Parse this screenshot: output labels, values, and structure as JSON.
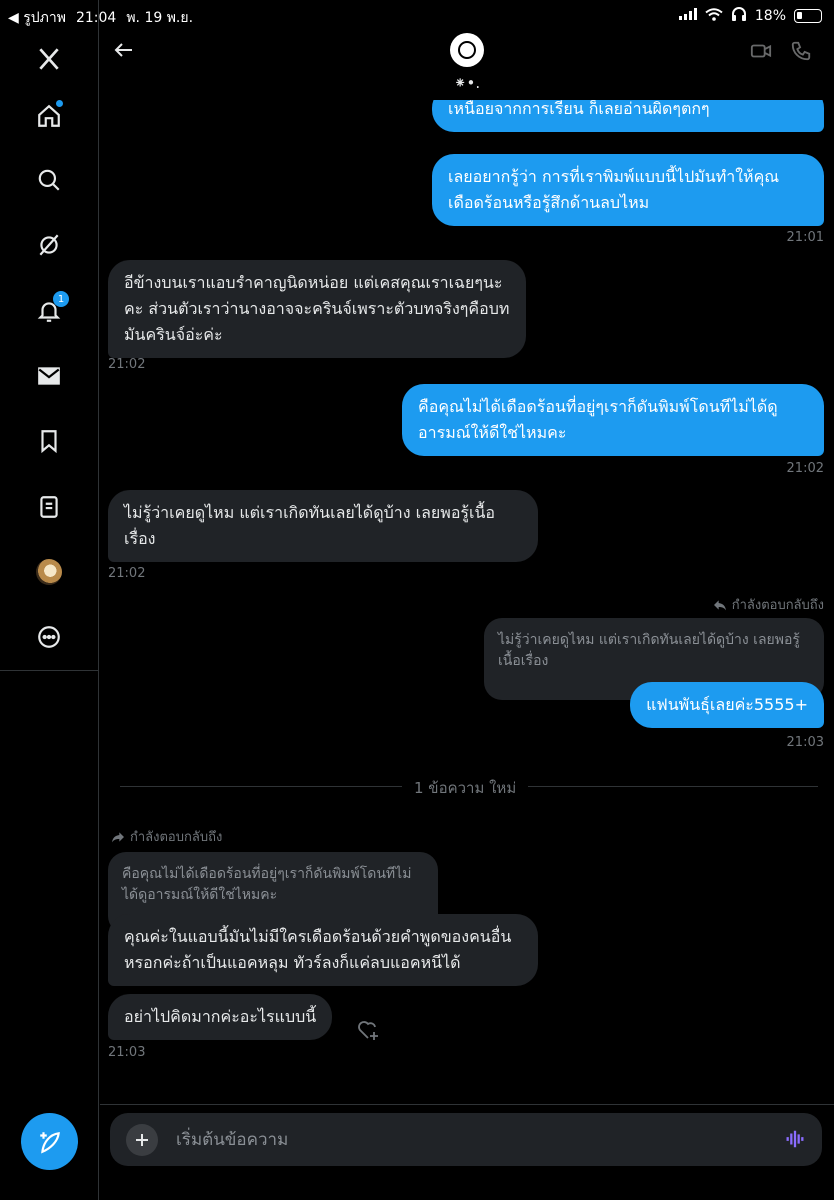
{
  "status_bar": {
    "back_app": "◀ รูปภาพ",
    "time": "21:04",
    "date": "พ. 19 พ.ย.",
    "battery": "18%"
  },
  "sidebar": {
    "notifications_badge": "1",
    "accent_color": "#1d9bf0"
  },
  "header": {
    "name": "⁕•."
  },
  "messages": [
    {
      "text": "เหนื่อยจากการเรียน ก็เลยอ่านผิดๆตกๆ"
    },
    {
      "text": "เลยอยากรู้ว่า การที่เราพิมพ์แบบนี้ไปมันทำให้คุณเดือดร้อนหรือรู้สึกด้านลบไหม",
      "time": "21:01"
    },
    {
      "text": "อีข้างบนเราแอบรำคาญนิดหน่อย แต่เคสคุณเราเฉยๆนะคะ ส่วนตัวเราว่านางอาจจะครินจ์เพราะตัวบทจริงๆคือบทมันครินจ์อ่ะค่ะ",
      "time": "21:02"
    },
    {
      "text": "คือคุณไม่ได้เดือดร้อนที่อยู่ๆเราก็ดันพิมพ์โดนทีไม่ได้ดูอารมณ์ให้ดีใช่ไหมคะ",
      "time": "21:02"
    },
    {
      "text": "ไม่รู้ว่าเคยดูไหม แต่เราเกิดทันเลยได้ดูบ้าง เลยพอรู้เนื้อเรื่อง",
      "time": "21:02"
    },
    {
      "reply_hint": "กำลังตอบกลับถึง",
      "quote": "ไม่รู้ว่าเคยดูไหม แต่เราเกิดทันเลยได้ดูบ้าง เลยพอรู้เนื้อเรื่อง",
      "text": "แฟนพันธุ์เลยค่ะ5555+",
      "time": "21:03"
    },
    {
      "reply_hint": "กำลังตอบกลับถึง",
      "quote": "คือคุณไม่ได้เดือดร้อนที่อยู่ๆเราก็ดันพิมพ์โดนทีไม่ได้ดูอารมณ์ให้ดีใช่ไหมคะ",
      "text": "คุณค่ะในแอบนี้มันไม่มีใครเดือดร้อนด้วยคำพูดของคนอื่นหรอกค่ะถ้าเป็นแอคหลุม ทัวร์ลงก็แค่ลบแอคหนีได้"
    },
    {
      "text": "อย่าไปคิดมากค่ะอะไรแบบนี้",
      "time": "21:03"
    }
  ],
  "new_messages_divider": "1 ข้อความ ใหม่",
  "composer": {
    "placeholder": "เริ่มต้นข้อความ"
  }
}
